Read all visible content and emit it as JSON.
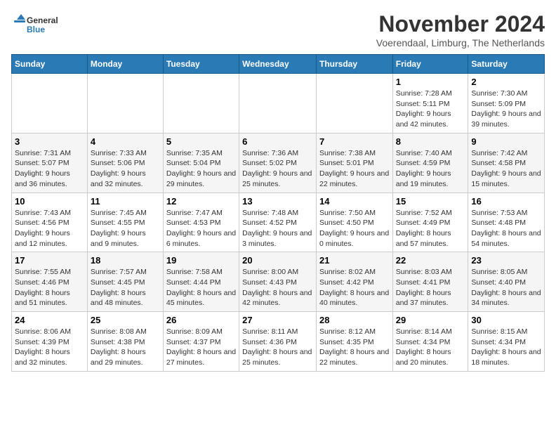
{
  "logo": {
    "general": "General",
    "blue": "Blue"
  },
  "title": "November 2024",
  "subtitle": "Voerendaal, Limburg, The Netherlands",
  "weekdays": [
    "Sunday",
    "Monday",
    "Tuesday",
    "Wednesday",
    "Thursday",
    "Friday",
    "Saturday"
  ],
  "weeks": [
    [
      {
        "day": "",
        "info": ""
      },
      {
        "day": "",
        "info": ""
      },
      {
        "day": "",
        "info": ""
      },
      {
        "day": "",
        "info": ""
      },
      {
        "day": "",
        "info": ""
      },
      {
        "day": "1",
        "info": "Sunrise: 7:28 AM\nSunset: 5:11 PM\nDaylight: 9 hours and 42 minutes."
      },
      {
        "day": "2",
        "info": "Sunrise: 7:30 AM\nSunset: 5:09 PM\nDaylight: 9 hours and 39 minutes."
      }
    ],
    [
      {
        "day": "3",
        "info": "Sunrise: 7:31 AM\nSunset: 5:07 PM\nDaylight: 9 hours and 36 minutes."
      },
      {
        "day": "4",
        "info": "Sunrise: 7:33 AM\nSunset: 5:06 PM\nDaylight: 9 hours and 32 minutes."
      },
      {
        "day": "5",
        "info": "Sunrise: 7:35 AM\nSunset: 5:04 PM\nDaylight: 9 hours and 29 minutes."
      },
      {
        "day": "6",
        "info": "Sunrise: 7:36 AM\nSunset: 5:02 PM\nDaylight: 9 hours and 25 minutes."
      },
      {
        "day": "7",
        "info": "Sunrise: 7:38 AM\nSunset: 5:01 PM\nDaylight: 9 hours and 22 minutes."
      },
      {
        "day": "8",
        "info": "Sunrise: 7:40 AM\nSunset: 4:59 PM\nDaylight: 9 hours and 19 minutes."
      },
      {
        "day": "9",
        "info": "Sunrise: 7:42 AM\nSunset: 4:58 PM\nDaylight: 9 hours and 15 minutes."
      }
    ],
    [
      {
        "day": "10",
        "info": "Sunrise: 7:43 AM\nSunset: 4:56 PM\nDaylight: 9 hours and 12 minutes."
      },
      {
        "day": "11",
        "info": "Sunrise: 7:45 AM\nSunset: 4:55 PM\nDaylight: 9 hours and 9 minutes."
      },
      {
        "day": "12",
        "info": "Sunrise: 7:47 AM\nSunset: 4:53 PM\nDaylight: 9 hours and 6 minutes."
      },
      {
        "day": "13",
        "info": "Sunrise: 7:48 AM\nSunset: 4:52 PM\nDaylight: 9 hours and 3 minutes."
      },
      {
        "day": "14",
        "info": "Sunrise: 7:50 AM\nSunset: 4:50 PM\nDaylight: 9 hours and 0 minutes."
      },
      {
        "day": "15",
        "info": "Sunrise: 7:52 AM\nSunset: 4:49 PM\nDaylight: 8 hours and 57 minutes."
      },
      {
        "day": "16",
        "info": "Sunrise: 7:53 AM\nSunset: 4:48 PM\nDaylight: 8 hours and 54 minutes."
      }
    ],
    [
      {
        "day": "17",
        "info": "Sunrise: 7:55 AM\nSunset: 4:46 PM\nDaylight: 8 hours and 51 minutes."
      },
      {
        "day": "18",
        "info": "Sunrise: 7:57 AM\nSunset: 4:45 PM\nDaylight: 8 hours and 48 minutes."
      },
      {
        "day": "19",
        "info": "Sunrise: 7:58 AM\nSunset: 4:44 PM\nDaylight: 8 hours and 45 minutes."
      },
      {
        "day": "20",
        "info": "Sunrise: 8:00 AM\nSunset: 4:43 PM\nDaylight: 8 hours and 42 minutes."
      },
      {
        "day": "21",
        "info": "Sunrise: 8:02 AM\nSunset: 4:42 PM\nDaylight: 8 hours and 40 minutes."
      },
      {
        "day": "22",
        "info": "Sunrise: 8:03 AM\nSunset: 4:41 PM\nDaylight: 8 hours and 37 minutes."
      },
      {
        "day": "23",
        "info": "Sunrise: 8:05 AM\nSunset: 4:40 PM\nDaylight: 8 hours and 34 minutes."
      }
    ],
    [
      {
        "day": "24",
        "info": "Sunrise: 8:06 AM\nSunset: 4:39 PM\nDaylight: 8 hours and 32 minutes."
      },
      {
        "day": "25",
        "info": "Sunrise: 8:08 AM\nSunset: 4:38 PM\nDaylight: 8 hours and 29 minutes."
      },
      {
        "day": "26",
        "info": "Sunrise: 8:09 AM\nSunset: 4:37 PM\nDaylight: 8 hours and 27 minutes."
      },
      {
        "day": "27",
        "info": "Sunrise: 8:11 AM\nSunset: 4:36 PM\nDaylight: 8 hours and 25 minutes."
      },
      {
        "day": "28",
        "info": "Sunrise: 8:12 AM\nSunset: 4:35 PM\nDaylight: 8 hours and 22 minutes."
      },
      {
        "day": "29",
        "info": "Sunrise: 8:14 AM\nSunset: 4:34 PM\nDaylight: 8 hours and 20 minutes."
      },
      {
        "day": "30",
        "info": "Sunrise: 8:15 AM\nSunset: 4:34 PM\nDaylight: 8 hours and 18 minutes."
      }
    ]
  ]
}
